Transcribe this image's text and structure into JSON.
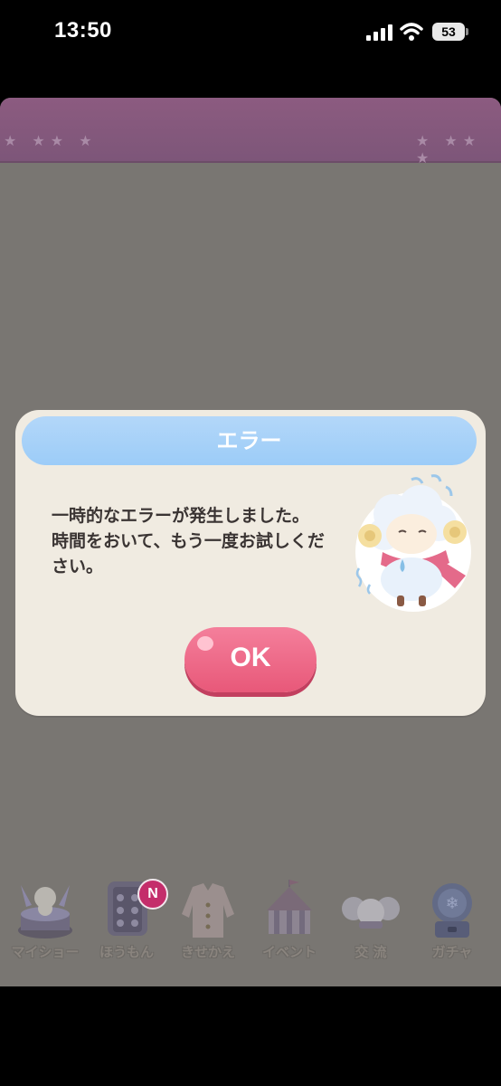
{
  "status_bar": {
    "time": "13:50",
    "battery": "53"
  },
  "dialog": {
    "title": "エラー",
    "message": "一時的なエラーが発生しました。\n時間をおいて、もう一度お試しくだ\nさい。",
    "ok_label": "OK"
  },
  "bottom_nav": {
    "items": [
      {
        "label": "マイショー",
        "icon": "music-box-icon"
      },
      {
        "label": "ほうもん",
        "icon": "door-icon"
      },
      {
        "label": "きせかえ",
        "icon": "coat-icon"
      },
      {
        "label": "イベント",
        "icon": "circus-tent-icon"
      },
      {
        "label": "交 流",
        "icon": "friends-icon"
      },
      {
        "label": "ガチャ",
        "icon": "gacha-icon"
      }
    ],
    "badge": "N"
  },
  "colors": {
    "dialog_bg": "#f0ebe1",
    "header_blue": "#9cccf8",
    "ok_pink": "#e85879",
    "overlay": "#797672",
    "banner_purple": "#8c5b80"
  }
}
